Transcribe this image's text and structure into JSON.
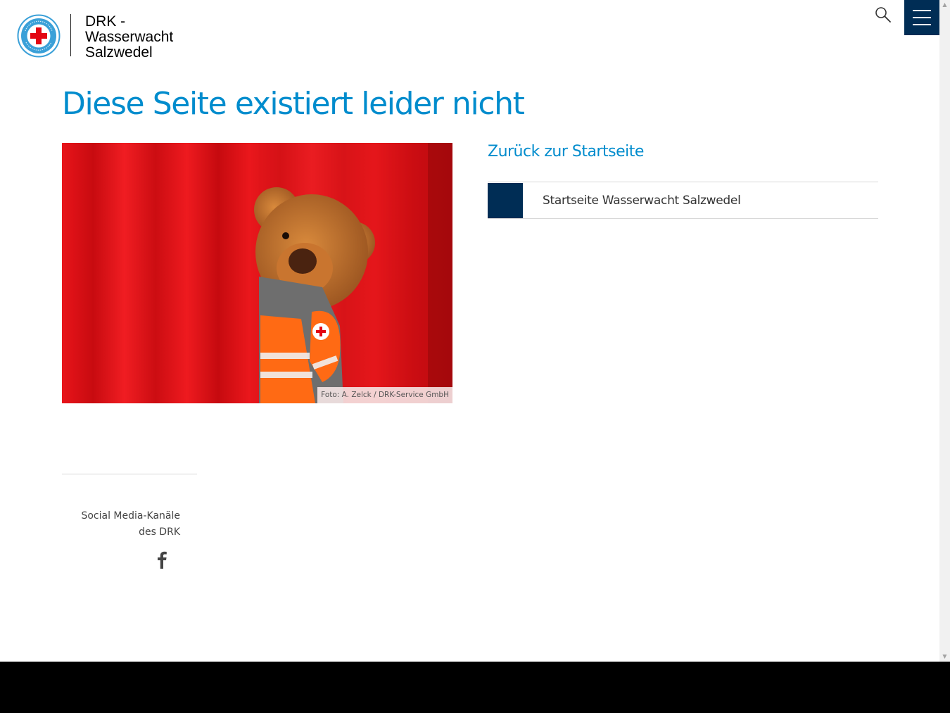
{
  "header": {
    "logo_lines": [
      "DRK -",
      "Wasserwacht",
      "Salzwedel"
    ],
    "search_icon": "search-icon",
    "menu_icon": "hamburger-menu-icon"
  },
  "main": {
    "title": "Diese Seite existiert leider nicht",
    "image_caption": "Foto: A. Zelck / DRK-Service GmbH",
    "back_heading": "Zurück zur Startseite",
    "home_link_label": "Startseite Wasserwacht Salzwedel"
  },
  "footer": {
    "social_label_lines": [
      "Social Media-Kanäle",
      "des DRK"
    ],
    "social_icon": "facebook-icon"
  },
  "colors": {
    "brand_blue": "#008ccd",
    "navy": "#002d55",
    "red_cross": "#e30613"
  }
}
